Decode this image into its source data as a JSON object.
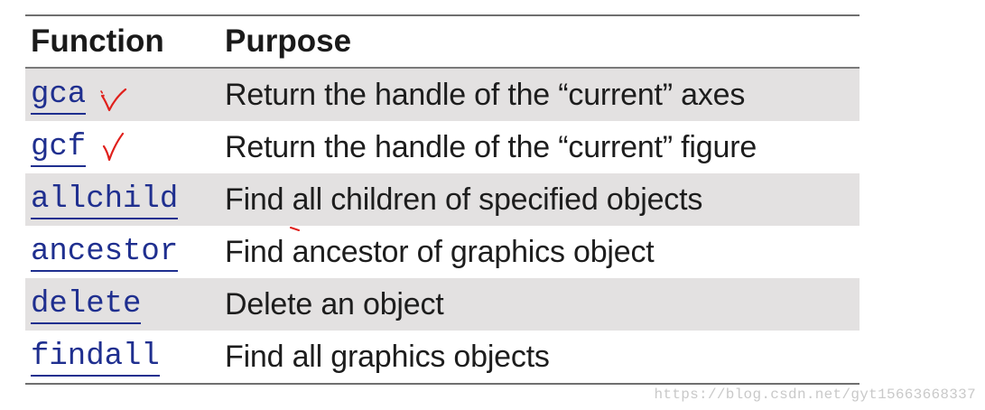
{
  "table": {
    "headers": {
      "function": "Function",
      "purpose": "Purpose"
    },
    "rows": [
      {
        "function": "gca",
        "purpose": "Return the handle of the “current” axes",
        "checked": true
      },
      {
        "function": "gcf",
        "purpose": "Return the handle of the “current” figure",
        "checked": true
      },
      {
        "function": "allchild",
        "purpose": "Find all children of specified objects",
        "checked": false
      },
      {
        "function": "ancestor",
        "purpose": "Find ancestor of graphics object",
        "checked": false
      },
      {
        "function": "delete",
        "purpose": "Delete an object",
        "checked": false
      },
      {
        "function": "findall",
        "purpose": "Find all graphics objects",
        "checked": false
      }
    ]
  },
  "watermark": "https://blog.csdn.net/gyt15663668337",
  "colors": {
    "link": "#1f2f8f",
    "shaded_row": "#e3e1e1",
    "annotation": "#e0201c",
    "watermark": "#c9c9c9"
  },
  "icons": {
    "annotation": "red-checkmark-icon"
  }
}
